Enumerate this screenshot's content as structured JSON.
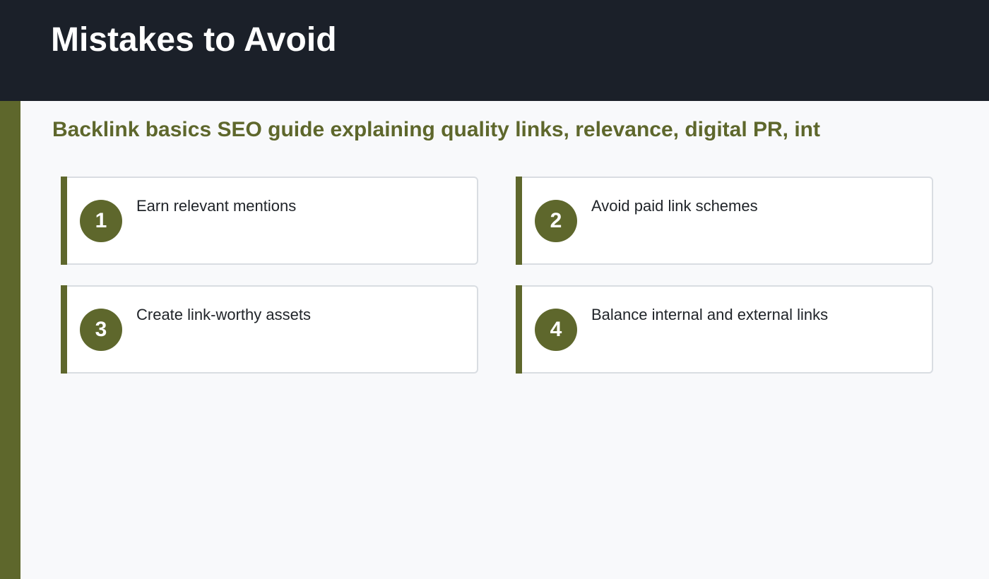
{
  "header": {
    "title": "Mistakes to Avoid"
  },
  "subtitle": "Backlink basics SEO guide explaining quality links, relevance, digital PR, int",
  "items": [
    {
      "number": "1",
      "label": "Earn relevant mentions"
    },
    {
      "number": "2",
      "label": "Avoid paid link schemes"
    },
    {
      "number": "3",
      "label": "Create link-worthy assets"
    },
    {
      "number": "4",
      "label": "Balance internal and external links"
    }
  ],
  "colors": {
    "header_background": "#1b2029",
    "accent": "#5e672c",
    "page_background": "#f8f9fb",
    "card_border": "#d9dde2"
  }
}
